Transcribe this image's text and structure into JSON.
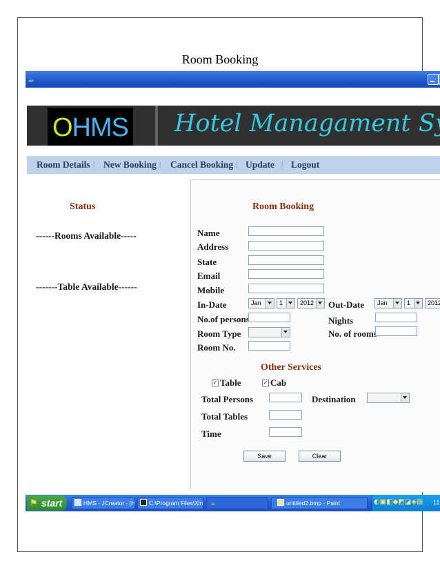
{
  "document_title": "Room Booking",
  "app": {
    "banner_logo": "OHMS",
    "banner_title": "Hotel Managament System"
  },
  "menu": [
    "Room Details",
    "New Booking",
    "Cancel Booking",
    "Update",
    "Logout"
  ],
  "menu_separator": "|",
  "left": {
    "status": "Status",
    "rooms_available": "------Rooms Available-----",
    "table_available": "-------Table Available------"
  },
  "form": {
    "title": "Room Booking",
    "labels": {
      "name": "Name",
      "address": "Address",
      "state": "State",
      "email": "Email",
      "mobile": "Mobile",
      "in_date": "In-Date",
      "out_date": "Out-Date",
      "persons": "No.of persons",
      "nights": "Nights",
      "room_type": "Room Type",
      "rooms": "No. of rooms",
      "room_no": "Room No."
    },
    "in_date": {
      "month": "Jan",
      "day": "1",
      "year": "2012"
    },
    "out_date": {
      "month": "Jan",
      "day": "1",
      "year": "2012"
    }
  },
  "other_services": {
    "title": "Other Services",
    "table_label": "Table",
    "cab_label": "Cab",
    "check_mark": "✓",
    "total_persons": "Total Persons",
    "destination": "Destination",
    "total_tables": "Total Tables",
    "time": "Time"
  },
  "buttons": {
    "save": "Save",
    "clear": "Clear"
  },
  "taskbar": {
    "start": "start",
    "items": [
      "HMS - JCreator - [Ho...",
      "C:\\Program Files\\Xino...",
      "untitled2.bmp - Paint"
    ],
    "clock": "11"
  },
  "icons": {
    "window": "coffee-cup-icon",
    "start": "windows-flag-icon"
  }
}
